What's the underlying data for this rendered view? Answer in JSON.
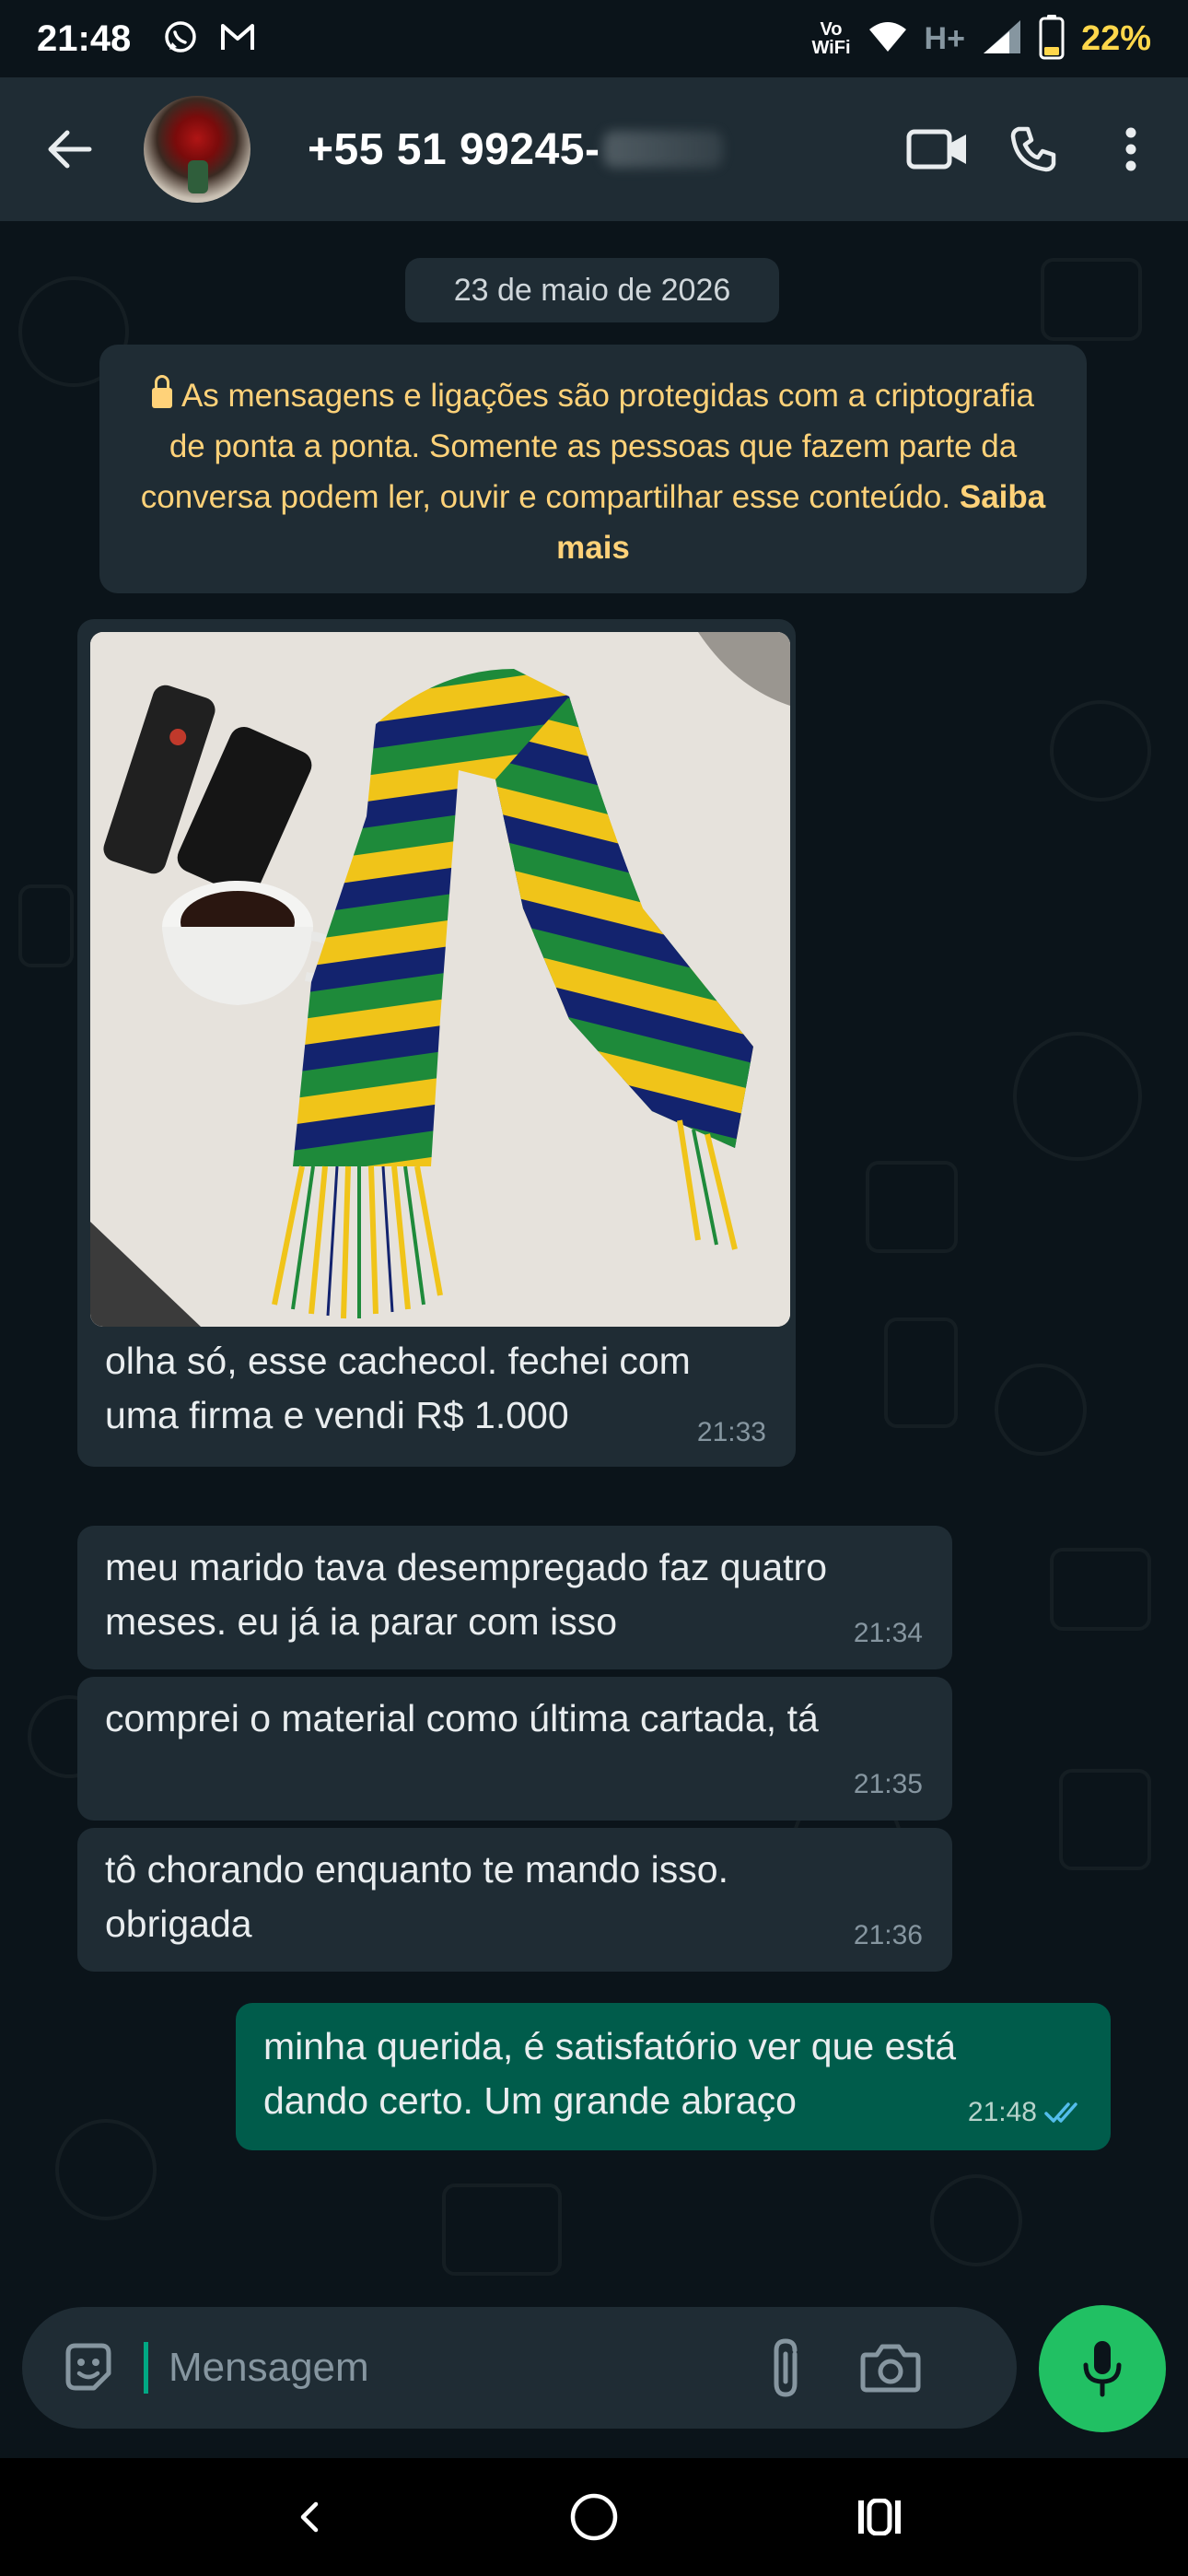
{
  "status_bar": {
    "time": "21:48",
    "network_label": "Vo WiFi",
    "network_line1": "Vo",
    "network_line2": "WiFi",
    "mobile_data": "H+",
    "battery": "22%",
    "icons": [
      "whatsapp-icon",
      "gmail-icon",
      "wifi-icon",
      "signal-icon",
      "battery-icon"
    ]
  },
  "header": {
    "contact_name": "+55 51 99245-",
    "actions": [
      "video-call-icon",
      "phone-icon",
      "more-options-icon"
    ]
  },
  "chat": {
    "date_chip": "23 de maio de 2026",
    "encryption_notice": {
      "text": "As mensagens e ligações são protegidas com a criptografia de ponta a ponta. Somente as pessoas que fazem parte da conversa podem ler, ouvir e compartilhar esse conteúdo.",
      "link": "Saiba mais"
    },
    "messages": [
      {
        "direction": "incoming",
        "type": "image",
        "text": "olha só, esse cachecol. fechei com uma firma e vendi R$ 1.000",
        "time": "21:33"
      },
      {
        "direction": "incoming",
        "type": "text",
        "text": "meu marido tava desempregado faz quatro meses. eu já ia parar com isso",
        "time": "21:34"
      },
      {
        "direction": "incoming",
        "type": "text",
        "text": "comprei o material como última cartada, tá",
        "time": "21:35"
      },
      {
        "direction": "incoming",
        "type": "text",
        "text": "tô chorando enquanto te mando isso. obrigada",
        "time": "21:36"
      },
      {
        "direction": "outgoing",
        "type": "text",
        "text": "minha querida, é satisfatório ver que está dando certo. Um grande abraço",
        "time": "21:48",
        "status": "read"
      }
    ]
  },
  "input": {
    "placeholder": "Mensagem"
  },
  "colors": {
    "background": "#0b141a",
    "header": "#1f2c34",
    "incoming_bubble": "#1f2c34",
    "outgoing_bubble": "#005c4b",
    "accent": "#21c063",
    "notice_text": "#ffd279",
    "read_ticks": "#53bdeb"
  }
}
